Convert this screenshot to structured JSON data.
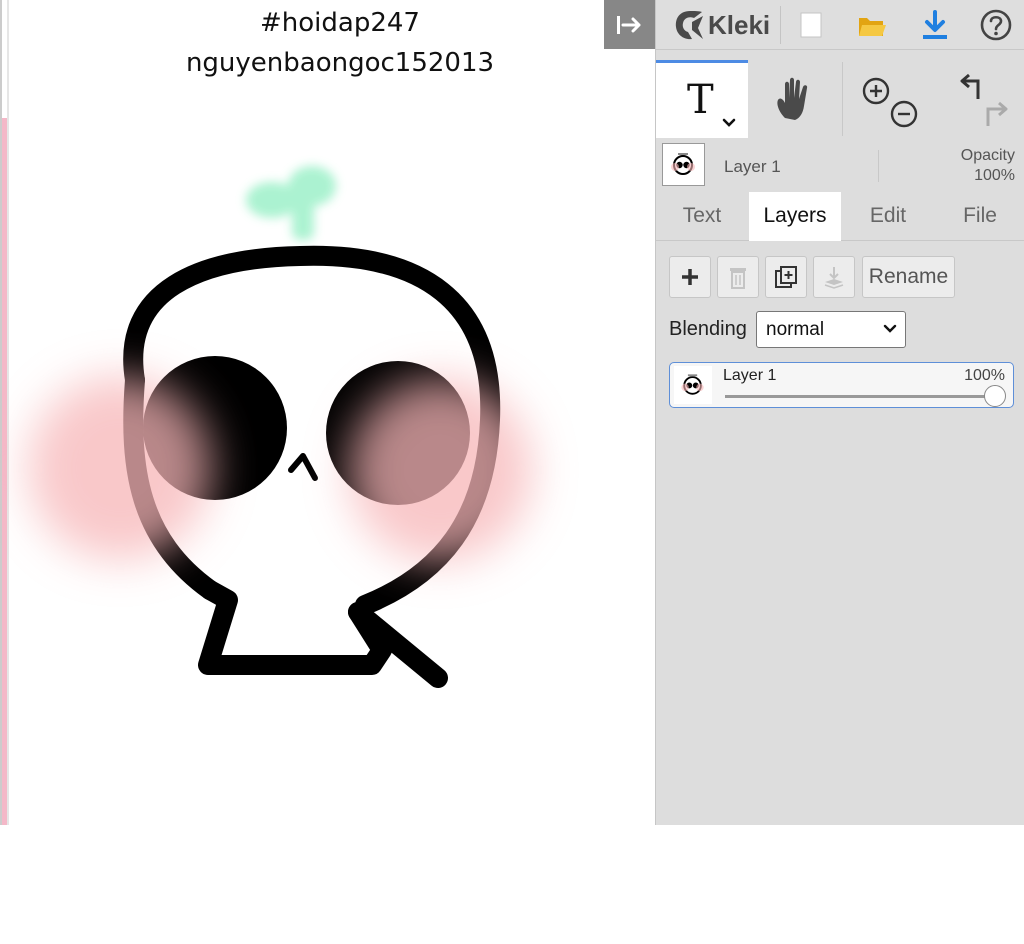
{
  "canvas": {
    "caption_line1": "#hoidap247",
    "caption_line2": "nguyenbaongoc152013"
  },
  "app": {
    "name": "Kleki"
  },
  "toolbar_icons": [
    "collapse-panel-icon",
    "kleki-logo-icon",
    "new-file-icon",
    "open-folder-icon",
    "download-icon",
    "help-icon"
  ],
  "tools": [
    "text-tool-icon",
    "hand-tool-icon",
    "zoom-in-icon",
    "zoom-out-icon",
    "undo-icon",
    "redo-icon"
  ],
  "current_layer": {
    "name": "Layer 1",
    "opacity_label": "Opacity",
    "opacity_value": "100%"
  },
  "tabs": [
    {
      "label": "Text",
      "active": false
    },
    {
      "label": "Layers",
      "active": true
    },
    {
      "label": "Edit",
      "active": false
    },
    {
      "label": "File",
      "active": false
    }
  ],
  "layer_buttons": {
    "icons": [
      "add-layer-icon",
      "delete-layer-icon",
      "duplicate-layer-icon",
      "merge-down-icon"
    ],
    "rename_label": "Rename"
  },
  "blending": {
    "label": "Blending",
    "value": "normal"
  },
  "layers": [
    {
      "name": "Layer 1",
      "opacity": "100%",
      "opacity_fraction": 1.0
    }
  ],
  "colors": {
    "accent": "#4d8be4",
    "panel_bg": "#dddddd",
    "download_blue": "#1f7fe0",
    "folder_yellow": "#f2b821",
    "sprout_green": "#9df0c8",
    "blush_pink": "#f7b6b8"
  }
}
